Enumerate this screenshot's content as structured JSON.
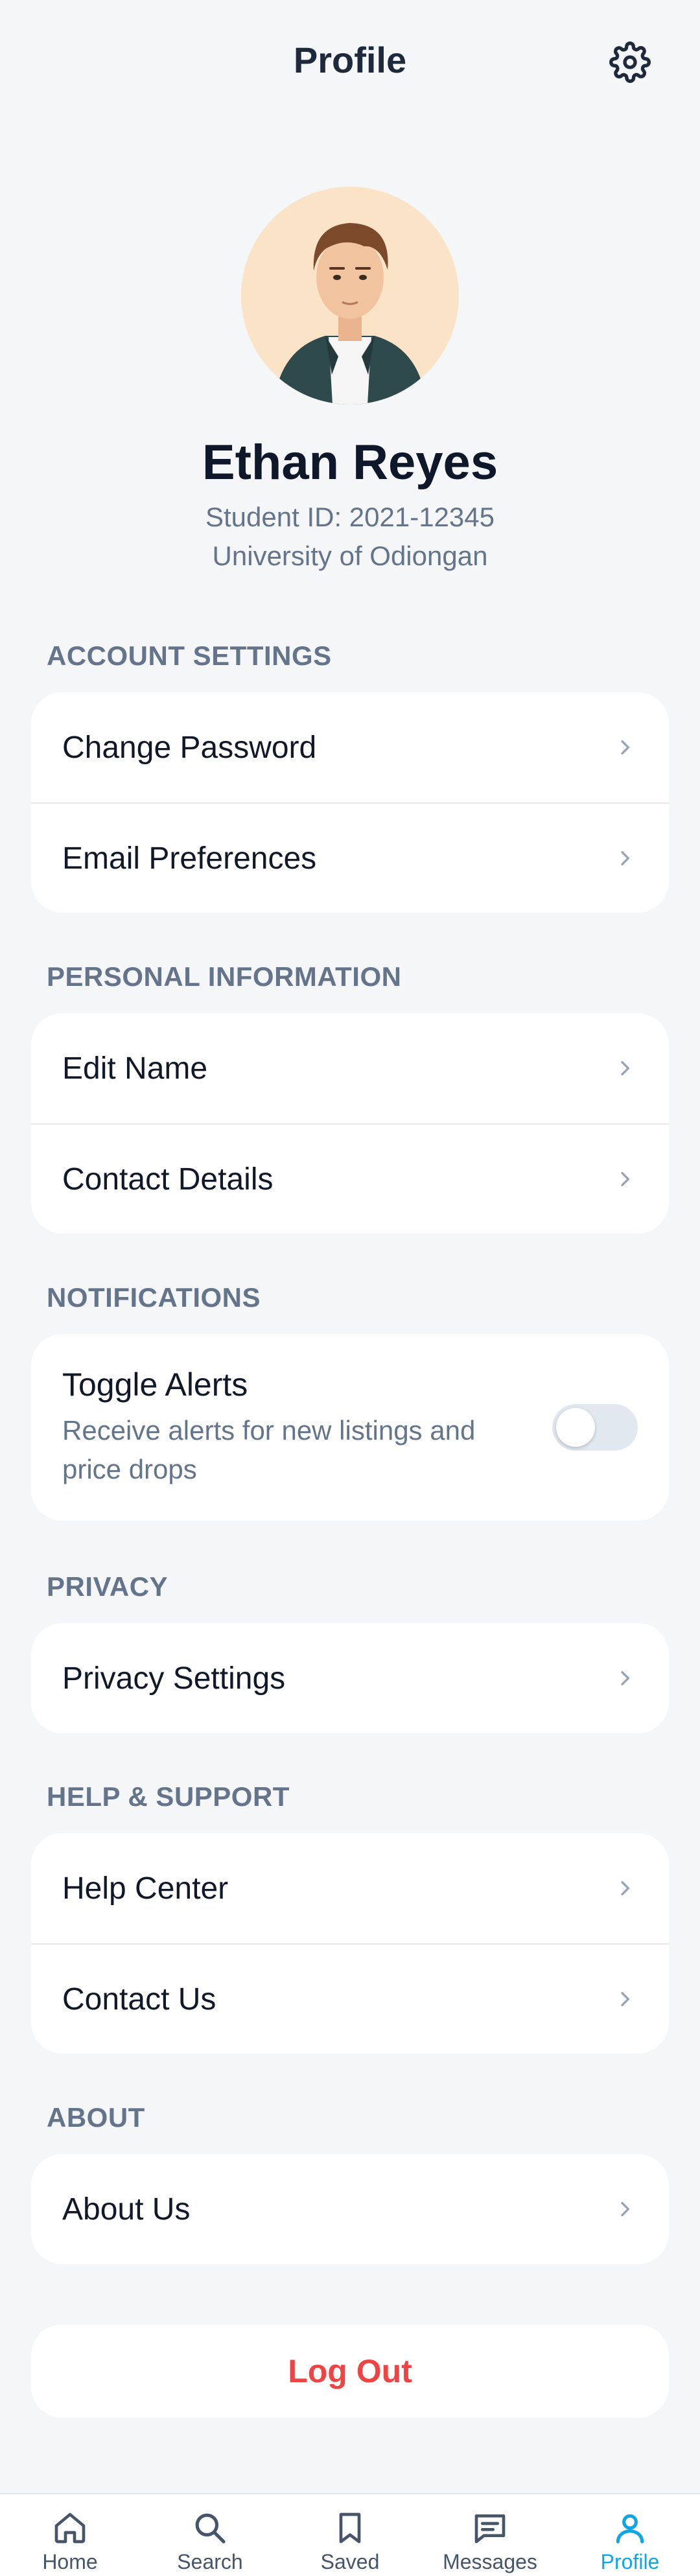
{
  "header": {
    "title": "Profile",
    "settings_icon": "gear-icon"
  },
  "profile": {
    "name": "Ethan Reyes",
    "student_id": "Student ID: 2021-12345",
    "university": "University of Odiongan",
    "avatar": "avatar-illustration"
  },
  "sections": {
    "account": {
      "label": "ACCOUNT SETTINGS",
      "items": [
        {
          "label": "Change Password"
        },
        {
          "label": "Email Preferences"
        }
      ]
    },
    "personal": {
      "label": "PERSONAL INFORMATION",
      "items": [
        {
          "label": "Edit Name"
        },
        {
          "label": "Contact Details"
        }
      ]
    },
    "notifications": {
      "label": "NOTIFICATIONS",
      "toggle_title": "Toggle Alerts",
      "toggle_desc": "Receive alerts for new listings and price drops",
      "toggle_on": false
    },
    "privacy": {
      "label": "PRIVACY",
      "items": [
        {
          "label": "Privacy Settings"
        }
      ]
    },
    "help": {
      "label": "HELP & SUPPORT",
      "items": [
        {
          "label": "Help Center"
        },
        {
          "label": "Contact Us"
        }
      ]
    },
    "about": {
      "label": "ABOUT",
      "items": [
        {
          "label": "About Us"
        }
      ]
    }
  },
  "logout_label": "Log Out",
  "tabs": [
    {
      "label": "Home",
      "icon": "home-icon"
    },
    {
      "label": "Search",
      "icon": "search-icon"
    },
    {
      "label": "Saved",
      "icon": "bookmark-icon"
    },
    {
      "label": "Messages",
      "icon": "message-icon"
    },
    {
      "label": "Profile",
      "icon": "user-icon",
      "active": true
    }
  ],
  "colors": {
    "accent": "#0ea5e9",
    "danger": "#ef4444",
    "muted": "#64748b",
    "background": "#f4f6f8"
  }
}
